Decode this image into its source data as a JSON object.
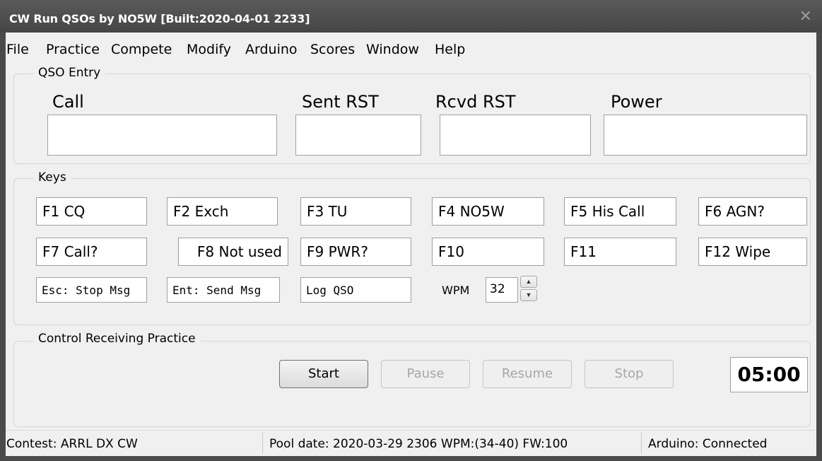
{
  "window": {
    "title": "CW Run QSOs by NO5W [Built:2020-04-01 2233]",
    "close_glyph": "✕"
  },
  "menu": [
    "File",
    "Practice",
    "Compete",
    "Modify",
    "Arduino",
    "Scores",
    "Window",
    "Help"
  ],
  "qso_entry": {
    "legend": "QSO Entry",
    "labels": {
      "call": "Call",
      "sent_rst": "Sent RST",
      "rcvd_rst": "Rcvd RST",
      "power": "Power"
    },
    "values": {
      "call": "",
      "sent_rst": "",
      "rcvd_rst": "",
      "power": ""
    }
  },
  "keys": {
    "legend": "Keys",
    "f1": "F1 CQ",
    "f2": "F2 Exch",
    "f3": "F3 TU",
    "f4": "F4 NO5W",
    "f5": "F5 His Call",
    "f6": "F6 AGN?",
    "f7": "F7 Call?",
    "f8": "F8 Not used",
    "f9": "F9 PWR?",
    "f10": "F10",
    "f11": "F11",
    "f12": "F12 Wipe",
    "esc": "Esc: Stop Msg",
    "ent": "Ent: Send Msg",
    "log": "Log QSO",
    "wpm_label": "WPM",
    "wpm_value": "32"
  },
  "control": {
    "legend": "Control Receiving Practice",
    "start": "Start",
    "pause": "Pause",
    "resume": "Resume",
    "stop": "Stop",
    "timer": "05:00"
  },
  "status": {
    "contest": "Contest: ARRL DX CW",
    "pool": "Pool date: 2020-03-29 2306  WPM:(34-40) FW:100",
    "arduino": "Arduino: Connected"
  },
  "icons": {
    "spin_up": "arrow-up-icon",
    "spin_down": "arrow-down-icon"
  }
}
